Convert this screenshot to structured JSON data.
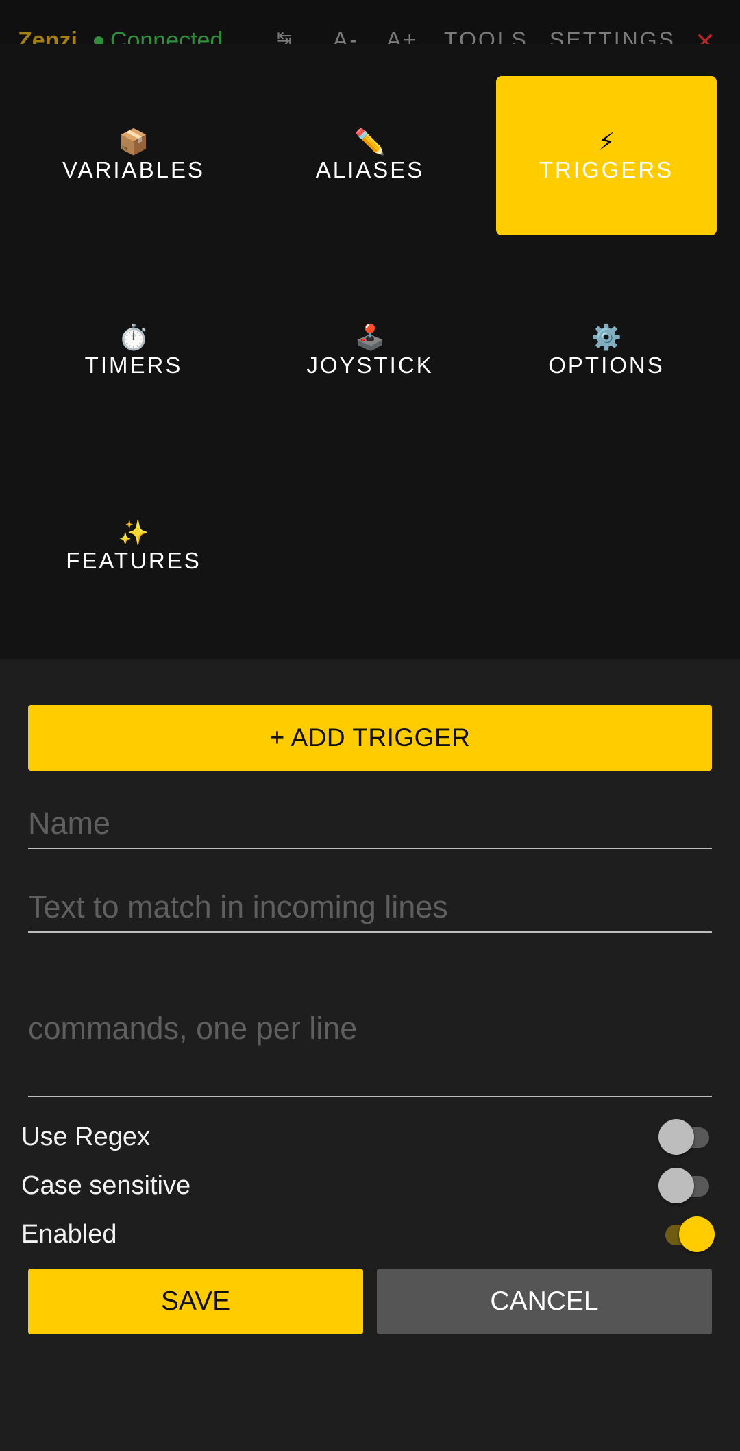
{
  "app_bar": {
    "title": "Zenzi",
    "status": "Connected",
    "sync_icon": "swap-icon",
    "font_decrease": "A-",
    "font_increase": "A+",
    "tools": "TOOLS",
    "settings": "SETTINGS",
    "close": "✕"
  },
  "menu": {
    "items": [
      {
        "icon": "📦",
        "icon_name": "package-icon",
        "label": "VARIABLES",
        "active": false
      },
      {
        "icon": "✏️",
        "icon_name": "pencil-icon",
        "label": "ALIASES",
        "active": false
      },
      {
        "icon": "⚡",
        "icon_name": "lightning-icon",
        "label": "TRIGGERS",
        "active": true
      },
      {
        "icon": "⏱️",
        "icon_name": "stopwatch-icon",
        "label": "TIMERS",
        "active": false
      },
      {
        "icon": "🕹️",
        "icon_name": "joystick-icon",
        "label": "JOYSTICK",
        "active": false
      },
      {
        "icon": "⚙️",
        "icon_name": "gear-icon",
        "label": "OPTIONS",
        "active": false
      },
      {
        "icon": "✨",
        "icon_name": "sparkles-icon",
        "label": "FEATURES",
        "active": false
      }
    ]
  },
  "form": {
    "add_button": "+ ADD TRIGGER",
    "name_placeholder": "Name",
    "name_value": "",
    "match_placeholder": "Text to match in incoming lines",
    "match_value": "",
    "commands_placeholder": "commands, one per line",
    "commands_value": "",
    "toggles": [
      {
        "label": "Use Regex",
        "on": false
      },
      {
        "label": "Case sensitive",
        "on": false
      },
      {
        "label": "Enabled",
        "on": true
      }
    ],
    "save": "SAVE",
    "cancel": "CANCEL"
  },
  "colors": {
    "accent": "#ffcc00",
    "menu_bg": "#131313",
    "form_bg": "#1e1e1e",
    "cancel_bg": "#555555",
    "connected": "#2f8f3a"
  }
}
